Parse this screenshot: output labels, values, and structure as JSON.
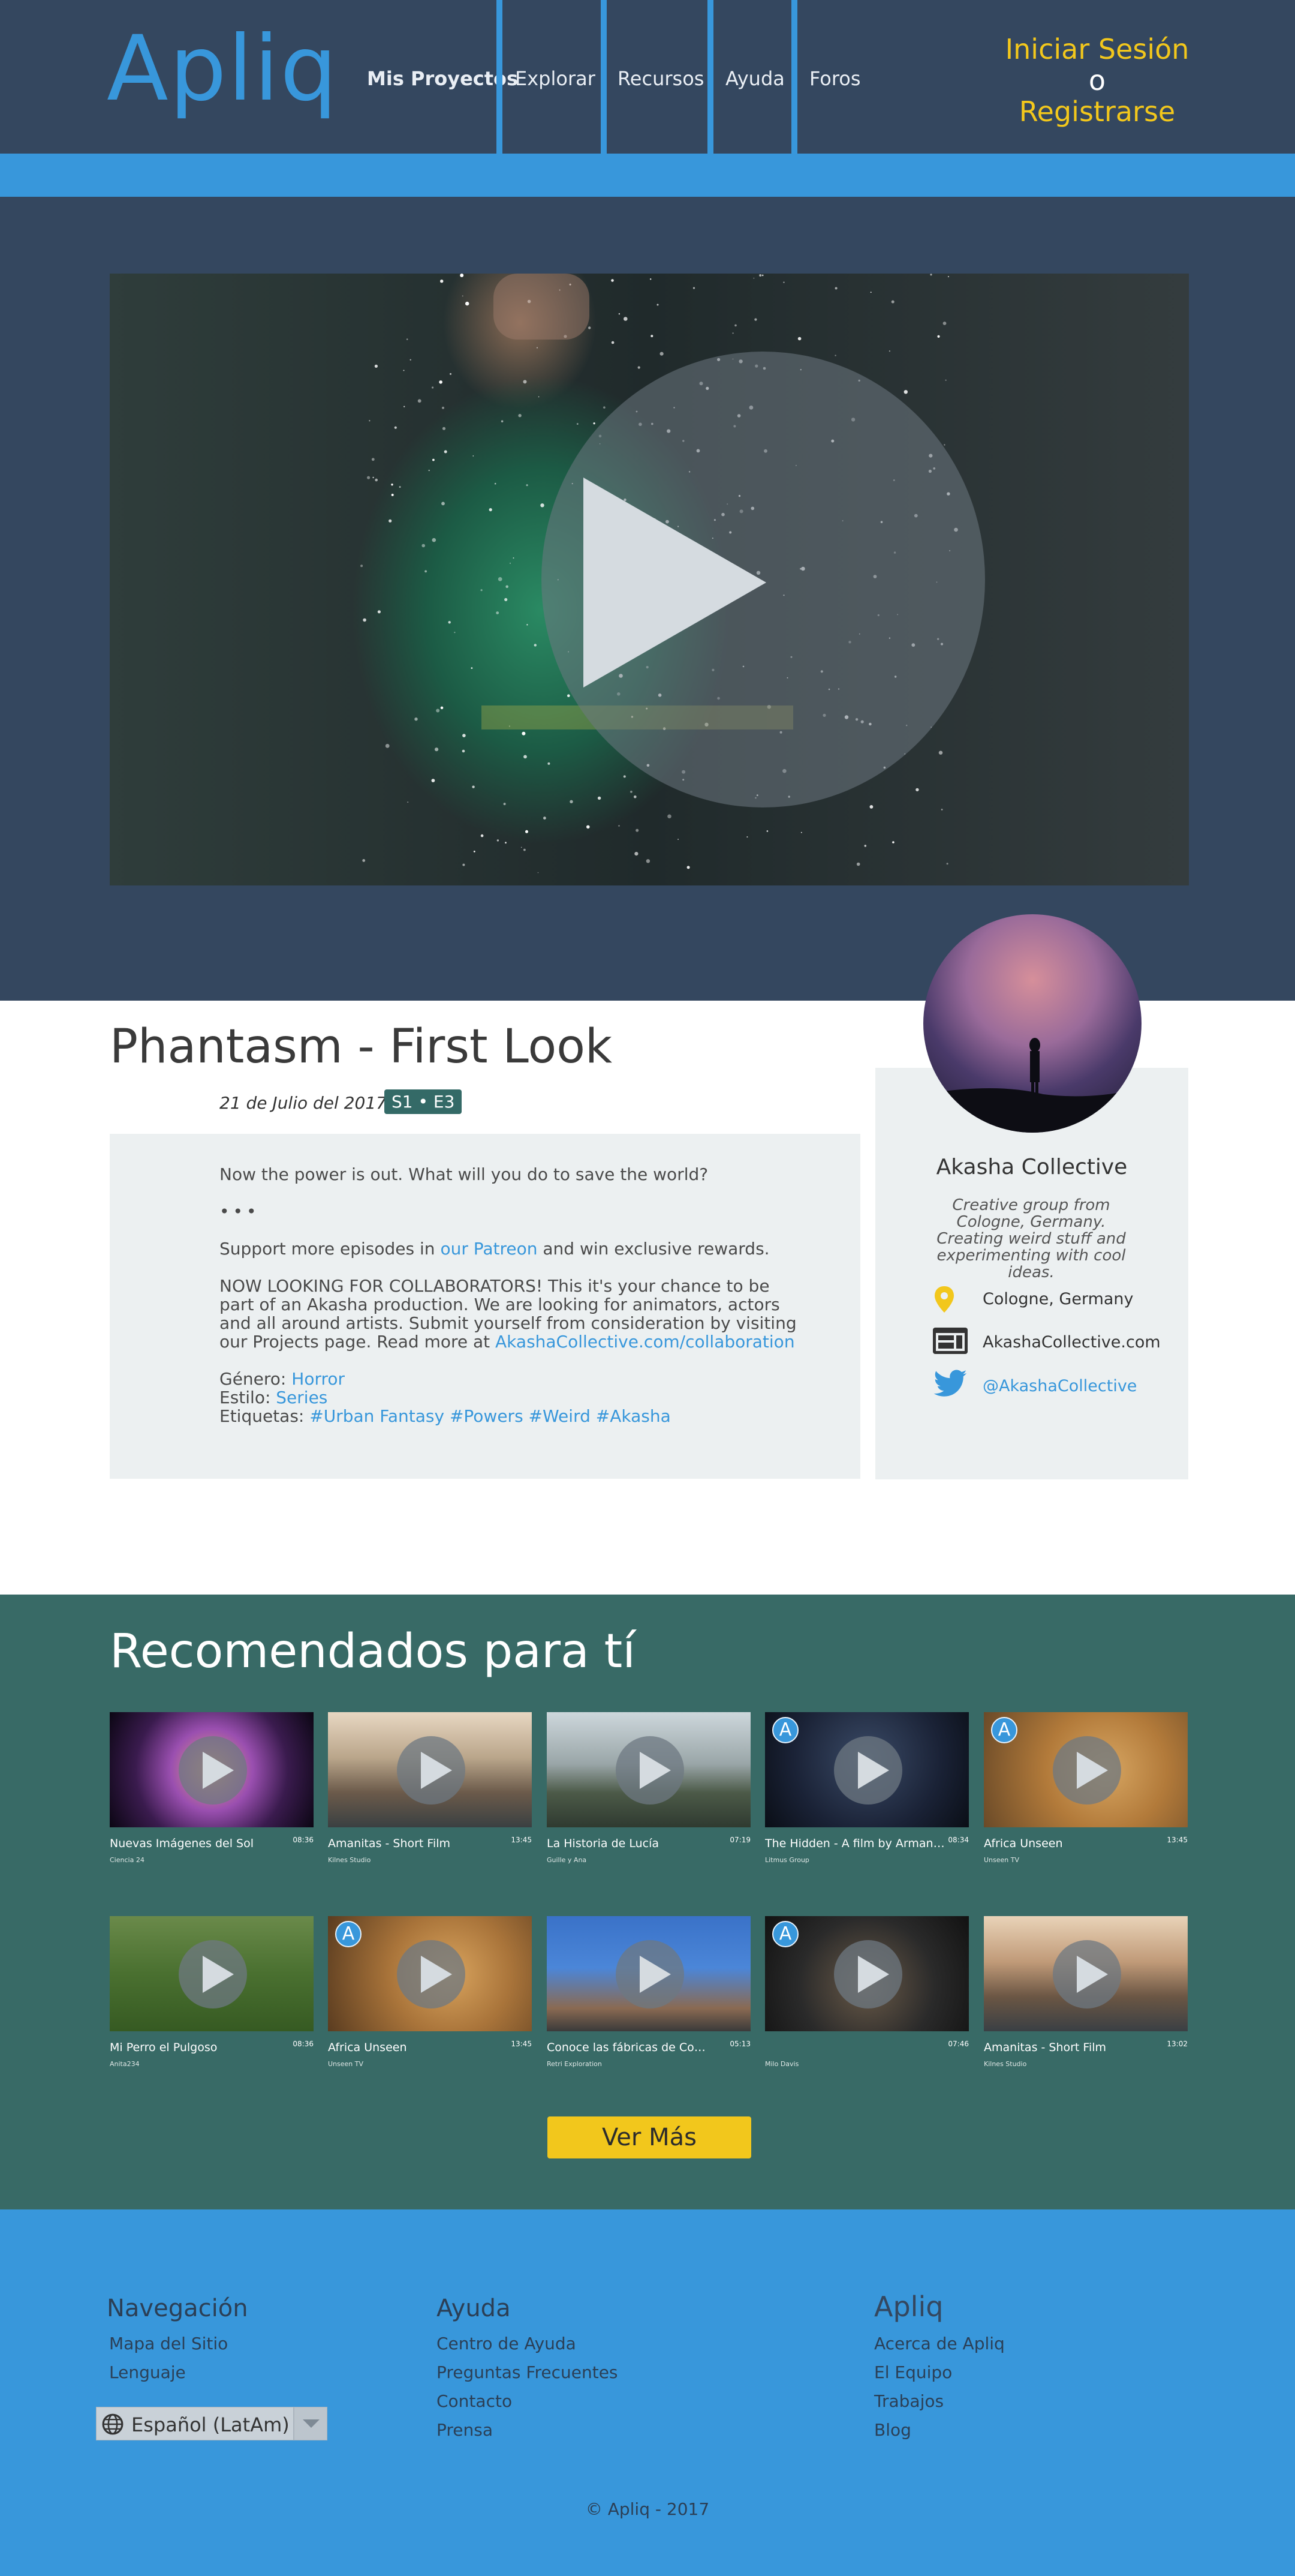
{
  "header": {
    "logo": "Apliq",
    "nav": [
      "Mis Proyectos",
      "Explorar",
      "Recursos",
      "Ayuda",
      "Foros"
    ],
    "login": "Iniciar Sesión",
    "or": "o",
    "register": "Registrarse"
  },
  "project": {
    "title": "Phantasm - First Look",
    "date": "21 de Julio del 2017",
    "episode": "S1 • E3",
    "description": {
      "line1": "Now the power is out. What will you do to save the world?",
      "dots": "•••",
      "support_prefix": "Support more episodes in ",
      "support_link": "our Patreon",
      "support_suffix": " and win exclusive rewards.",
      "collab": "NOW LOOKING FOR COLLABORATORS! This it's your chance to be part of an Akasha production. We are looking for animators, actors and all around artists. Submit yourself from consideration by visiting our Projects page. Read more at ",
      "collab_link": "AkashaCollective.com/collaboration",
      "genre_label": "Género: ",
      "genre": "Horror",
      "style_label": "Estilo: ",
      "style": "Series",
      "tags_label": "Etiquetas: ",
      "tags": "#Urban Fantasy #Powers #Weird #Akasha"
    }
  },
  "creator": {
    "name": "Akasha Collective",
    "bio": "Creative group from Cologne, Germany. Creating weird stuff and experimenting with cool ideas.",
    "location": "Cologne, Germany",
    "website": "AkashaCollective.com",
    "twitter": "@AkashaCollective",
    "icons": [
      "location-pin-icon",
      "website-icon",
      "twitter-icon"
    ]
  },
  "recommendations": {
    "title": "Recomendados para tí",
    "more_button": "Ver Más",
    "items": [
      {
        "title": "Nuevas Imágenes del Sol",
        "duration": "08:36",
        "author": "Ciencia 24",
        "badge": ""
      },
      {
        "title": "Amanitas - Short Film",
        "duration": "13:45",
        "author": "Kilnes Studio",
        "badge": ""
      },
      {
        "title": "La Historia de Lucía",
        "duration": "07:19",
        "author": "Guille y Ana",
        "badge": ""
      },
      {
        "title": "The Hidden - A film by Arman…",
        "duration": "08:34",
        "author": "Litmus Group",
        "badge": "A"
      },
      {
        "title": "Africa Unseen",
        "duration": "13:45",
        "author": "Unseen TV",
        "badge": "A"
      },
      {
        "title": "Mi Perro el Pulgoso",
        "duration": "08:36",
        "author": "Anita234",
        "badge": ""
      },
      {
        "title": "Africa Unseen",
        "duration": "13:45",
        "author": "Unseen TV",
        "badge": "A"
      },
      {
        "title": "Conoce las fábricas de Co…",
        "duration": "05:13",
        "author": "Retri Exploration",
        "badge": ""
      },
      {
        "title": "",
        "duration": "07:46",
        "author": "Milo Davis",
        "badge": "A"
      },
      {
        "title": "Amanitas - Short Film",
        "duration": "13:02",
        "author": "Kilnes Studio",
        "badge": ""
      }
    ]
  },
  "footer": {
    "nav_title": "Navegación",
    "nav_links": [
      "Mapa del Sitio",
      "Lenguaje"
    ],
    "language": "Español (LatAm)",
    "help_title": "Ayuda",
    "help_links": [
      "Centro de Ayuda",
      "Preguntas Frecuentes",
      "Contacto",
      "Prensa"
    ],
    "brand_title": "Apliq",
    "brand_links": [
      "Acerca de Apliq",
      "El Equipo",
      "Trabajos",
      "Blog"
    ],
    "copyright": "© Apliq - 2017"
  },
  "colors": {
    "header_bg": "#34475f",
    "accent_blue": "#3897db",
    "accent_yellow": "#f2c71c",
    "recs_bg": "#386a66",
    "panel_bg": "#ecf0f1"
  }
}
